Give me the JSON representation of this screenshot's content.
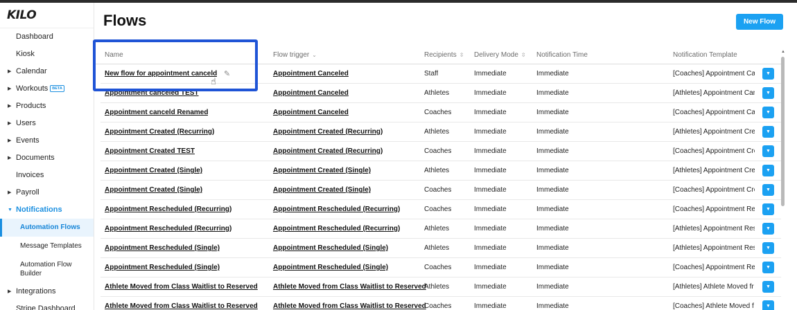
{
  "app": {
    "logo": "KILO"
  },
  "sidebar": {
    "items": [
      {
        "label": "Dashboard",
        "caret": false
      },
      {
        "label": "Kiosk",
        "caret": false
      },
      {
        "label": "Calendar",
        "caret": true
      },
      {
        "label": "Workouts",
        "caret": true,
        "badge": "BETA"
      },
      {
        "label": "Products",
        "caret": true
      },
      {
        "label": "Users",
        "caret": true
      },
      {
        "label": "Events",
        "caret": true
      },
      {
        "label": "Documents",
        "caret": true
      },
      {
        "label": "Invoices",
        "caret": false
      },
      {
        "label": "Payroll",
        "caret": true
      },
      {
        "label": "Notifications",
        "caret": true,
        "expanded": true
      }
    ],
    "subitems": [
      {
        "label": "Automation Flows",
        "selected": true
      },
      {
        "label": "Message Templates"
      },
      {
        "label": "Automation Flow Builder"
      }
    ],
    "after": [
      {
        "label": "Integrations",
        "caret": true
      },
      {
        "label": "Stripe Dashboard",
        "caret": false
      }
    ]
  },
  "header": {
    "title": "Flows",
    "new_flow_label": "New Flow"
  },
  "table": {
    "columns": {
      "name": "Name",
      "trigger": "Flow trigger",
      "recipients": "Recipients",
      "mode": "Delivery Mode",
      "time": "Notification Time",
      "template": "Notification Template"
    },
    "rows": [
      {
        "name": "New flow for appointment canceld",
        "trigger": "Appointment Canceled",
        "recipients": "Staff",
        "mode": "Immediate",
        "time": "Immediate",
        "template": "[Coaches] Appointment Ca"
      },
      {
        "name": "Appointment canceled TEST",
        "trigger": "Appointment Canceled",
        "recipients": "Athletes",
        "mode": "Immediate",
        "time": "Immediate",
        "template": "[Athletes] Appointment Car"
      },
      {
        "name": "Appointment canceld Renamed",
        "trigger": "Appointment Canceled",
        "recipients": "Coaches",
        "mode": "Immediate",
        "time": "Immediate",
        "template": "[Coaches] Appointment Ca"
      },
      {
        "name": "Appointment Created (Recurring)",
        "trigger": "Appointment Created (Recurring)",
        "recipients": "Athletes",
        "mode": "Immediate",
        "time": "Immediate",
        "template": "[Athletes] Appointment Cre"
      },
      {
        "name": "Appointment Created TEST",
        "trigger": "Appointment Created (Recurring)",
        "recipients": "Coaches",
        "mode": "Immediate",
        "time": "Immediate",
        "template": "[Coaches] Appointment Cre"
      },
      {
        "name": "Appointment Created (Single)",
        "trigger": "Appointment Created (Single)",
        "recipients": "Athletes",
        "mode": "Immediate",
        "time": "Immediate",
        "template": "[Athletes] Appointment Cre"
      },
      {
        "name": "Appointment Created (Single)",
        "trigger": "Appointment Created (Single)",
        "recipients": "Coaches",
        "mode": "Immediate",
        "time": "Immediate",
        "template": "[Coaches] Appointment Cre"
      },
      {
        "name": "Appointment Rescheduled (Recurring)",
        "trigger": "Appointment Rescheduled (Recurring)",
        "recipients": "Coaches",
        "mode": "Immediate",
        "time": "Immediate",
        "template": "[Coaches] Appointment Re"
      },
      {
        "name": "Appointment Rescheduled (Recurring)",
        "trigger": "Appointment Rescheduled (Recurring)",
        "recipients": "Athletes",
        "mode": "Immediate",
        "time": "Immediate",
        "template": "[Athletes] Appointment Res"
      },
      {
        "name": "Appointment Rescheduled (Single)",
        "trigger": "Appointment Rescheduled (Single)",
        "recipients": "Athletes",
        "mode": "Immediate",
        "time": "Immediate",
        "template": "[Athletes] Appointment Res"
      },
      {
        "name": "Appointment Rescheduled (Single)",
        "trigger": "Appointment Rescheduled (Single)",
        "recipients": "Coaches",
        "mode": "Immediate",
        "time": "Immediate",
        "template": "[Coaches] Appointment Re"
      },
      {
        "name": "Athlete Moved from Class Waitlist to Reserved",
        "trigger": "Athlete Moved from Class Waitlist to Reserved",
        "recipients": "Athletes",
        "mode": "Immediate",
        "time": "Immediate",
        "template": "[Athletes] Athlete Moved fr"
      },
      {
        "name": "Athlete Moved from Class Waitlist to Reserved",
        "trigger": "Athlete Moved from Class Waitlist to Reserved",
        "recipients": "Coaches",
        "mode": "Immediate",
        "time": "Immediate",
        "template": "[Coaches] Athlete Moved f"
      }
    ]
  },
  "colors": {
    "accent": "#1ba1f2",
    "highlight_border": "#1f54d6",
    "nav_active": "#1a8fe0"
  }
}
